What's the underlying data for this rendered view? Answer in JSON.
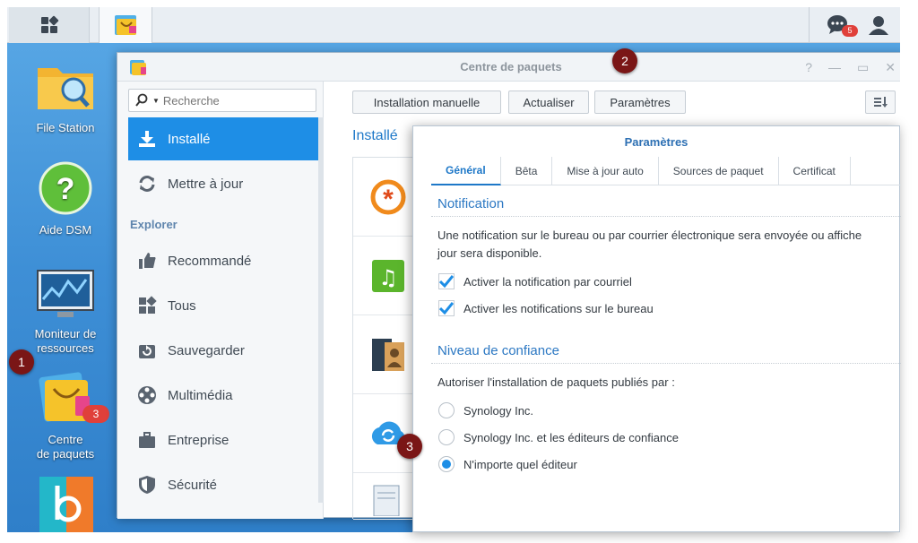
{
  "taskbar": {
    "chat_badge": "5"
  },
  "desktop": {
    "icons": [
      {
        "label": "File Station"
      },
      {
        "label": "Aide DSM"
      },
      {
        "label_line1": "Moniteur de",
        "label_line2": "ressources"
      },
      {
        "label_line1": "Centre",
        "label_line2": "de paquets",
        "badge": "3"
      }
    ]
  },
  "window": {
    "title": "Centre de paquets",
    "sidebar": {
      "search_placeholder": "Recherche",
      "items_top": [
        "Installé",
        "Mettre à jour"
      ],
      "section": "Explorer",
      "items_explore": [
        "Recommandé",
        "Tous",
        "Sauvegarder",
        "Multimédia",
        "Entreprise",
        "Sécurité"
      ]
    },
    "toolbar": {
      "manual_install": "Installation manuelle",
      "refresh": "Actualiser",
      "settings": "Paramètres"
    },
    "installed_heading": "Installé"
  },
  "dialog": {
    "title": "Paramètres",
    "tabs": [
      "Général",
      "Bêta",
      "Mise à jour auto",
      "Sources de paquet",
      "Certificat"
    ],
    "notification": {
      "heading": "Notification",
      "desc_line1": "Une notification sur le bureau ou par courrier électronique sera envoyée ou affiche",
      "desc_line2": "jour sera disponible.",
      "email_label": "Activer la notification par courriel",
      "desktop_label": "Activer les notifications sur le bureau"
    },
    "trust": {
      "heading": "Niveau de confiance",
      "prompt": "Autoriser l'installation de paquets publiés par :",
      "options": [
        "Synology Inc.",
        "Synology Inc. et les éditeurs de confiance",
        "N'importe quel éditeur"
      ],
      "selected": "N'importe quel éditeur"
    }
  },
  "markers": [
    "1",
    "2",
    "3"
  ],
  "colors": {
    "accent": "#1e8ee6",
    "marker": "#7a1616",
    "badge": "#e0403a"
  }
}
